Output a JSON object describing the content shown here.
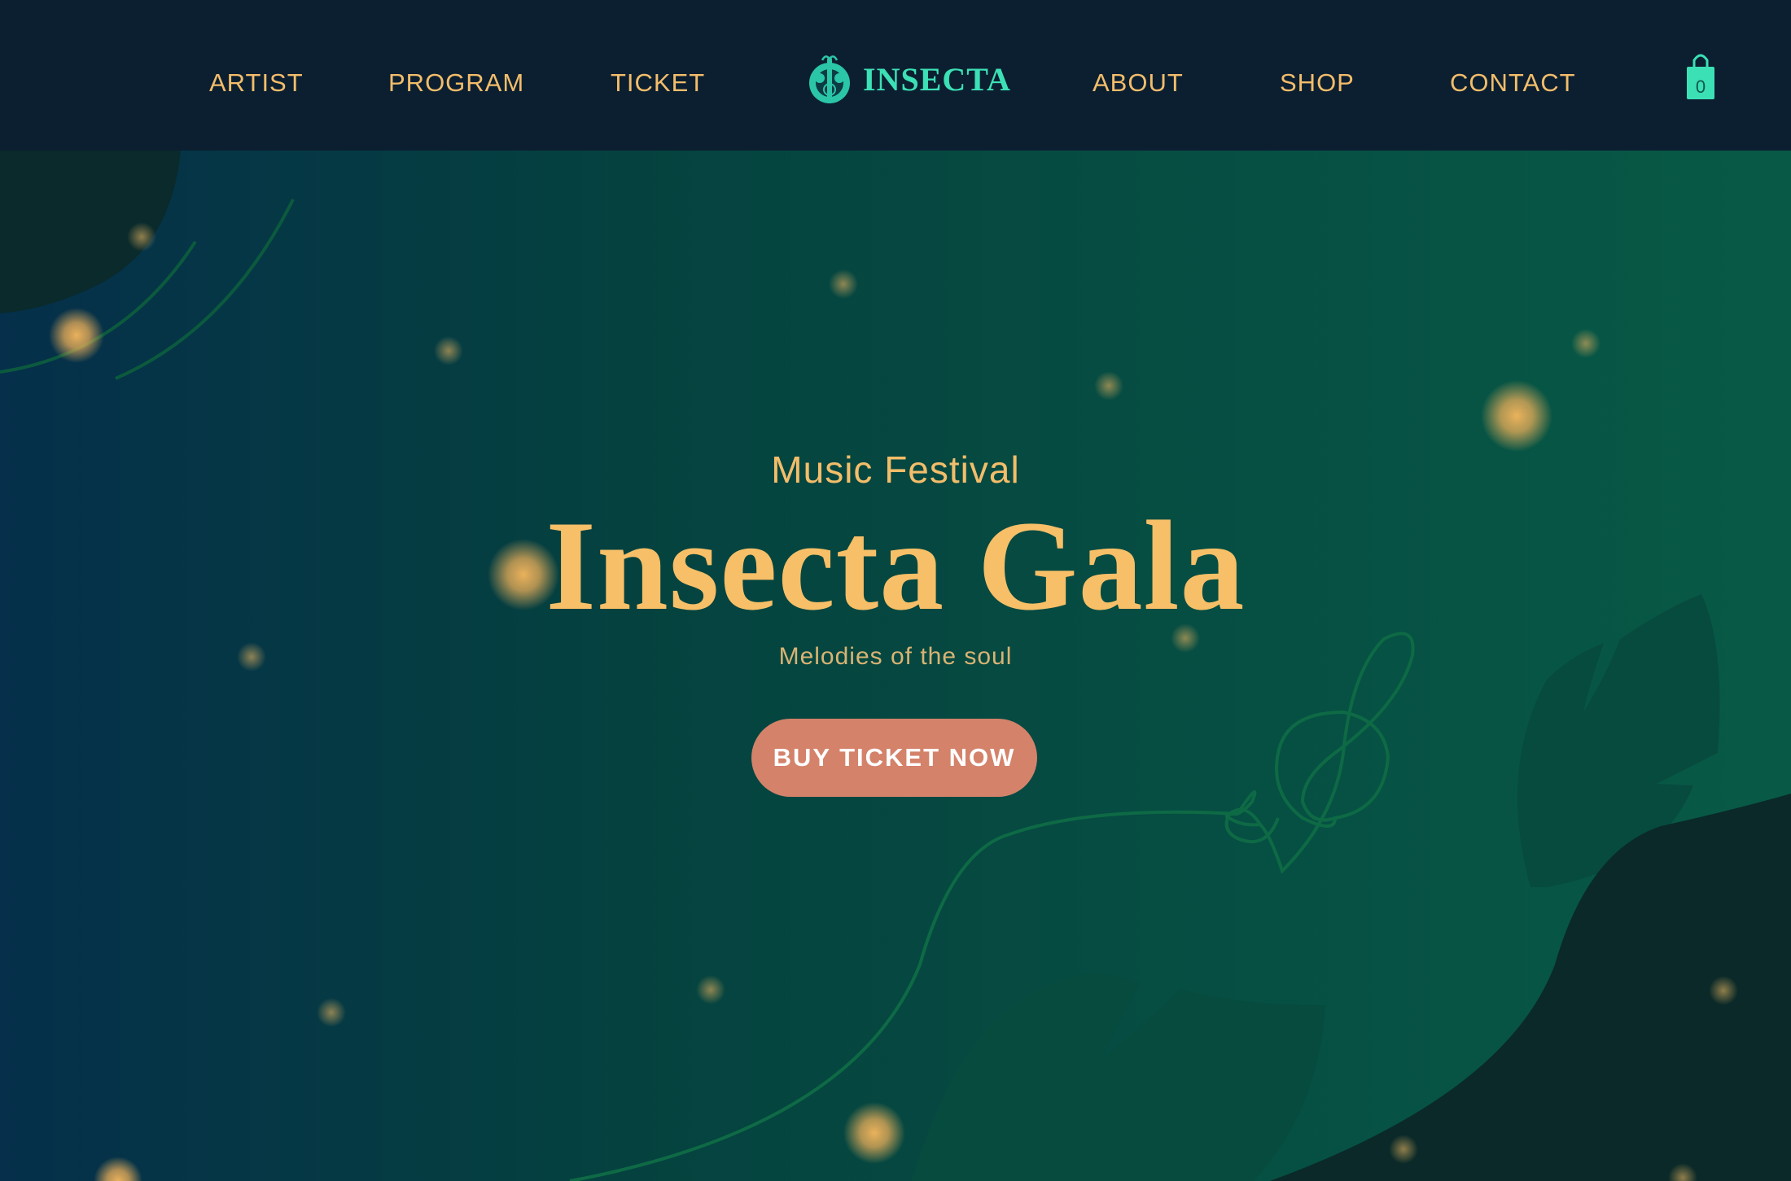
{
  "nav": {
    "left_links": [
      {
        "label": "ARTIST"
      },
      {
        "label": "PROGRAM"
      },
      {
        "label": "TICKET"
      }
    ],
    "right_links": [
      {
        "label": "ABOUT"
      },
      {
        "label": "SHOP"
      },
      {
        "label": "CONTACT"
      }
    ],
    "logo": {
      "text": "INSECTA",
      "icon": "beetle-guitar-logo-icon"
    },
    "cart": {
      "count": "0",
      "icon": "shopping-bag-icon"
    }
  },
  "hero": {
    "subtitle": "Music Festival",
    "title": "Insecta Gala",
    "tagline": "Melodies of the soul",
    "cta_label": "BUY TICKET NOW",
    "decor_icons": [
      "treble-clef-icon",
      "leaf-icon",
      "firefly-glow-icon"
    ]
  },
  "colors": {
    "nav_bg": "#0c1f31",
    "accent_gold": "#f3bd6a",
    "logo_teal": "#3ce0b5",
    "cta_bg": "#d4826a",
    "hero_left": "#052f4a",
    "hero_right": "#085a46"
  }
}
